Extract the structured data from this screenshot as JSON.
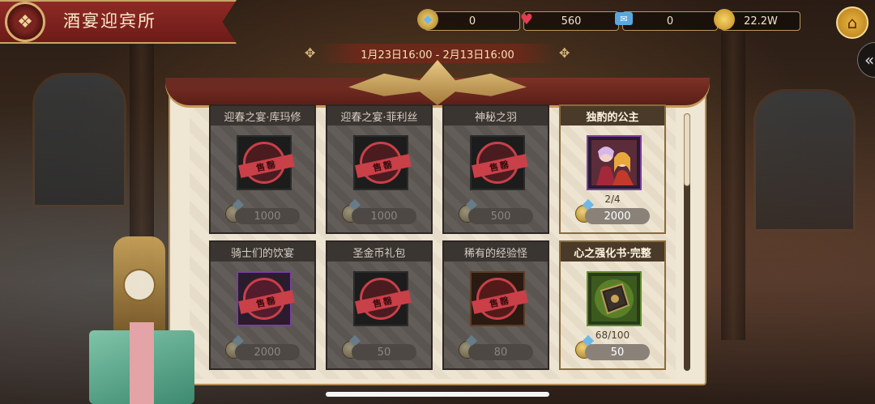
{
  "header": {
    "title": "酒宴迎宾所"
  },
  "currencies": [
    {
      "icon": "gold-gem-coin-icon",
      "value": "0",
      "color": "#d9b04a"
    },
    {
      "icon": "red-heart-ticket-icon",
      "value": "560",
      "color": "#d4344a"
    },
    {
      "icon": "blue-letter-ticket-icon",
      "value": "0",
      "color": "#5aa7e0"
    },
    {
      "icon": "gold-coin-icon",
      "value": "22.2W",
      "color": "#e6b93a"
    }
  ],
  "event": {
    "date_range": "1月23日16:00 - 2月13日16:00"
  },
  "stamp_text": "售罄",
  "items": [
    {
      "title": "迎春之宴·库玛修",
      "price": "1000",
      "sold_out": true,
      "progress": ""
    },
    {
      "title": "迎春之宴·菲利丝",
      "price": "1000",
      "sold_out": true,
      "progress": ""
    },
    {
      "title": "神秘之羽",
      "price": "500",
      "sold_out": true,
      "progress": ""
    },
    {
      "title": "独酌的公主",
      "price": "2000",
      "sold_out": false,
      "progress": "2/4"
    },
    {
      "title": "骑士们的饮宴",
      "price": "2000",
      "sold_out": true,
      "progress": ""
    },
    {
      "title": "圣金币礼包",
      "price": "50",
      "sold_out": true,
      "progress": ""
    },
    {
      "title": "稀有的经验怪",
      "price": "80",
      "sold_out": true,
      "progress": ""
    },
    {
      "title": "心之强化书·完整",
      "price": "50",
      "sold_out": false,
      "progress": "68/100"
    }
  ]
}
